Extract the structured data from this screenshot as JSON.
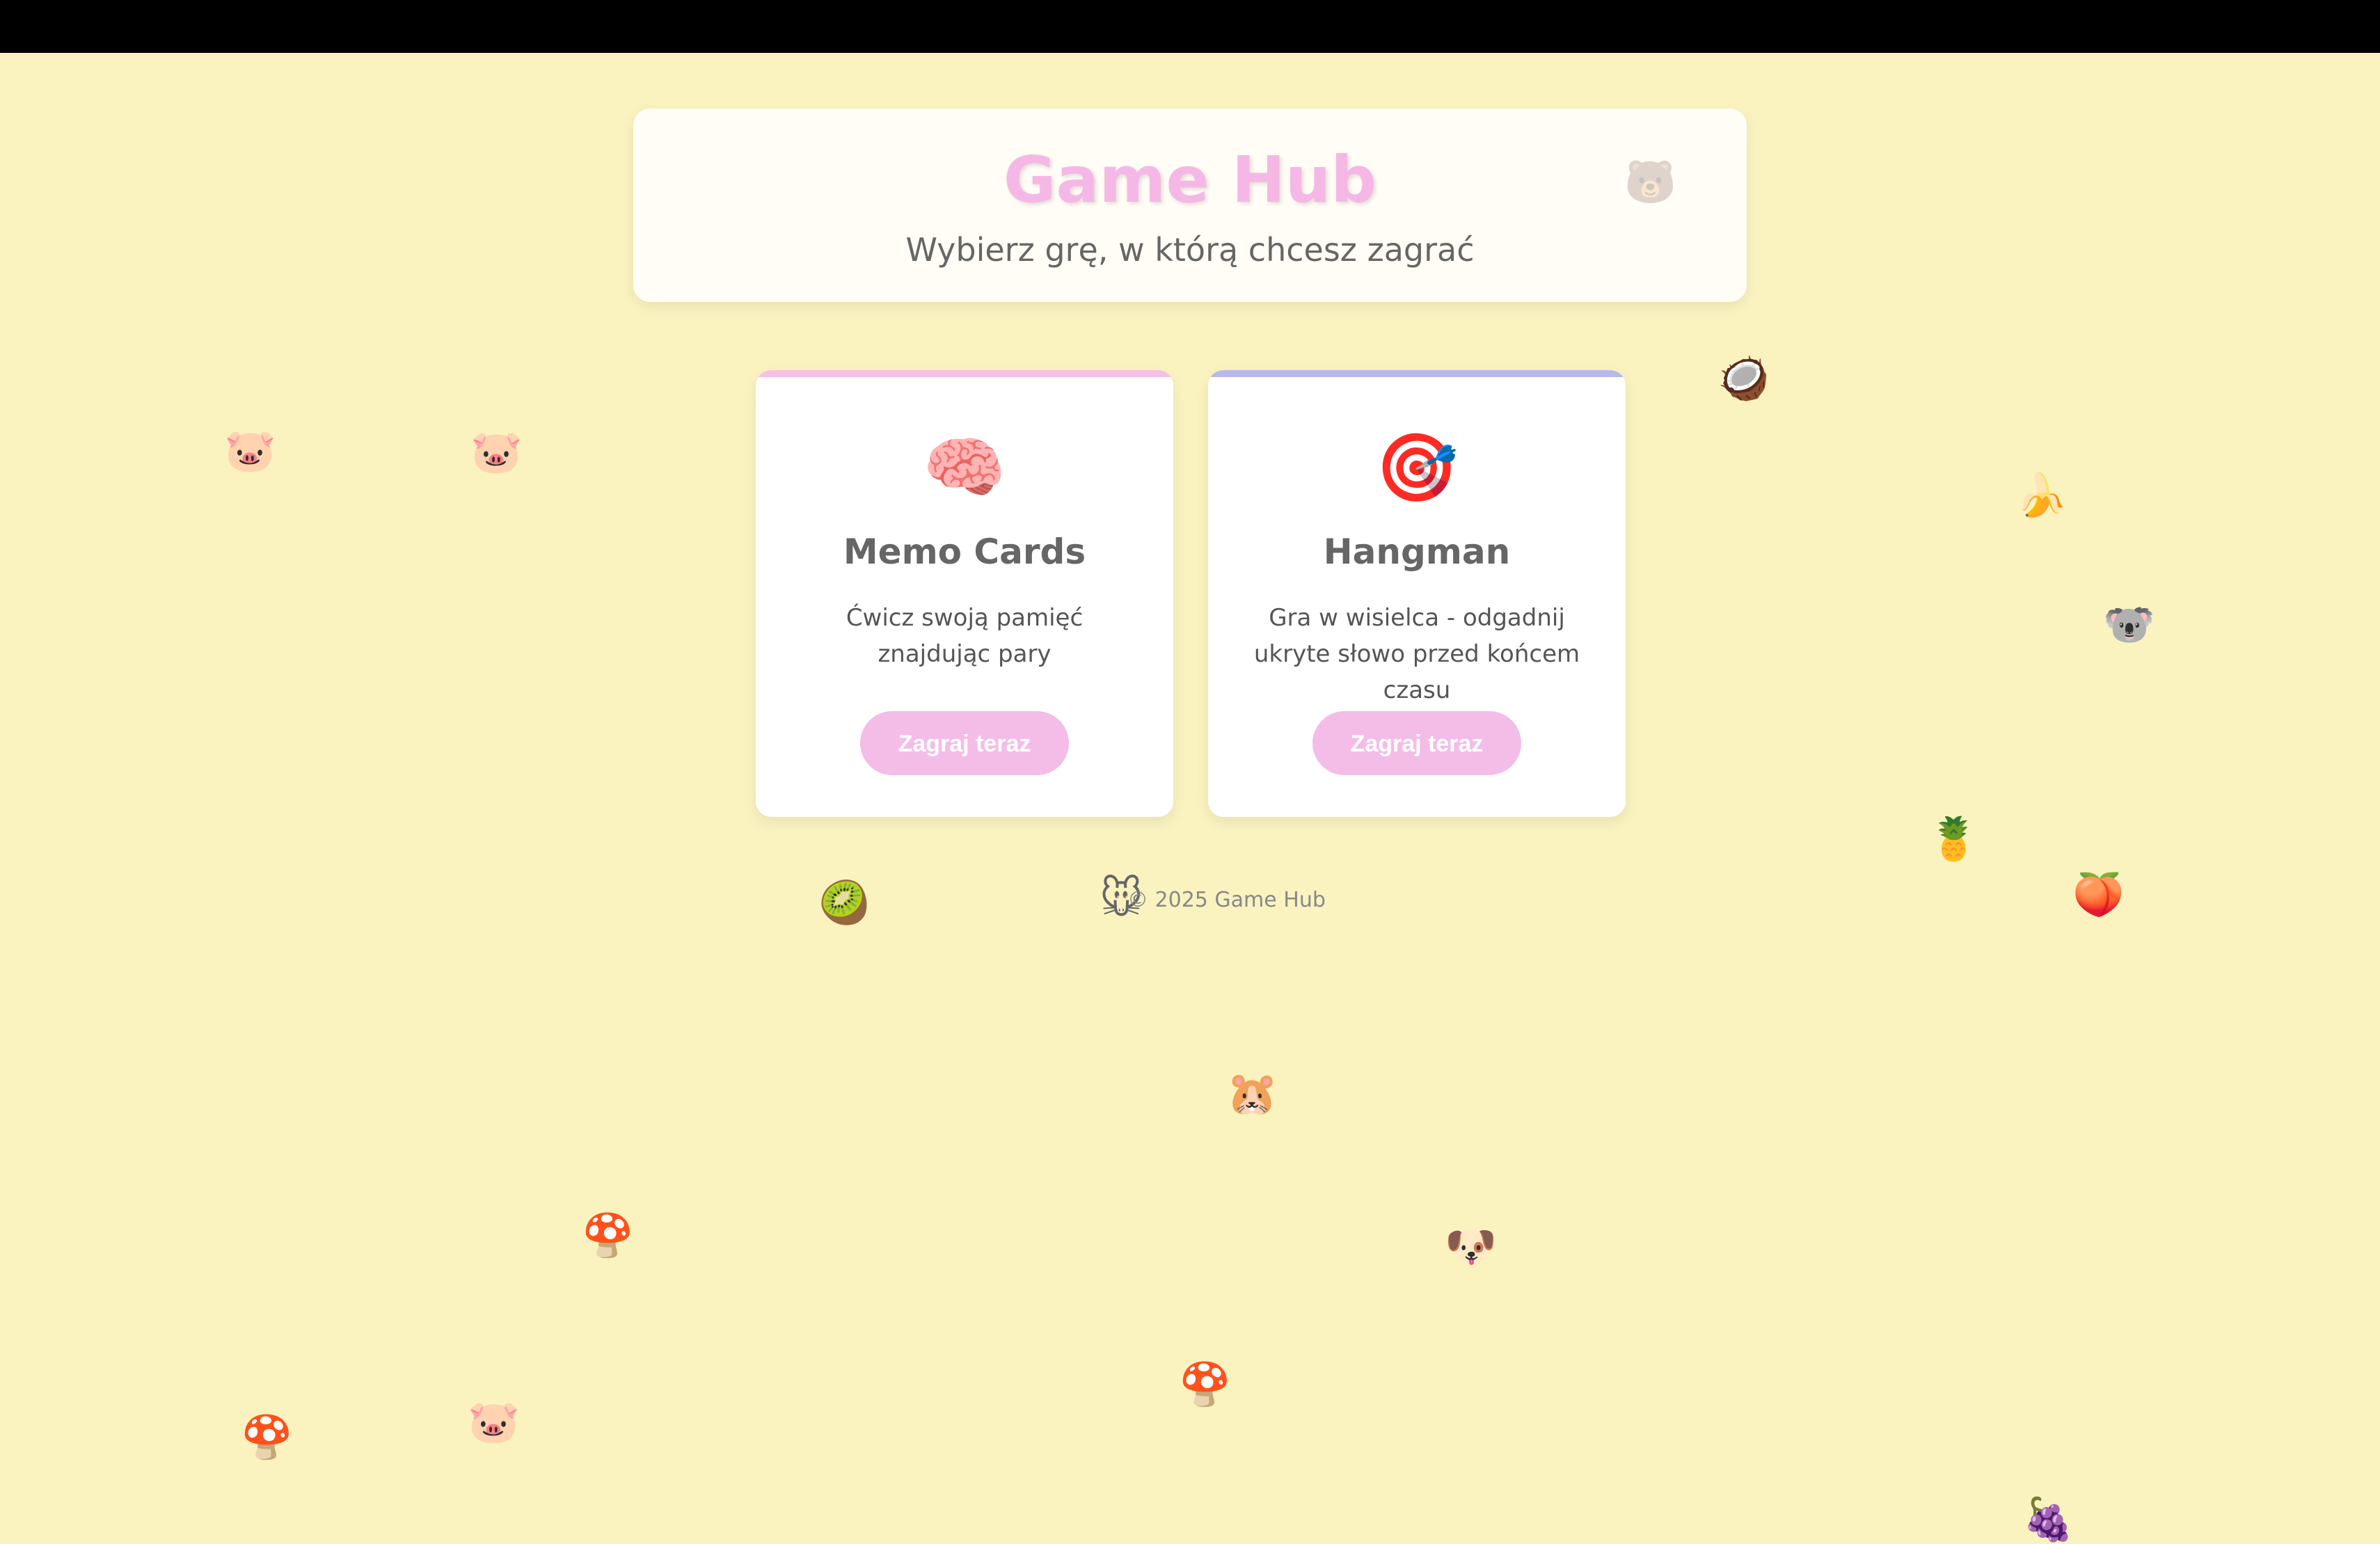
{
  "header": {
    "title": "Game Hub",
    "subtitle": "Wybierz grę, w którą chcesz zagrać",
    "corner_decor": "🐻"
  },
  "games": [
    {
      "icon": "🧠",
      "icon_name": "brain-icon",
      "name": "Memo Cards",
      "description": "Ćwicz swoją pamięć znajdując pary",
      "button_label": "Zagraj teraz",
      "accent_color": "#f6bfe7"
    },
    {
      "icon": "🎯",
      "icon_name": "target-icon",
      "name": "Hangman",
      "description": "Gra w wisielca - odgadnij ukryte słowo przed końcem czasu",
      "button_label": "Zagraj teraz",
      "accent_color": "#b9b8ee"
    }
  ],
  "footer": {
    "text": "© 2025 Game Hub"
  },
  "colors": {
    "background": "#faf3c0",
    "title_pink": "#f5b8e6",
    "button_pink": "#f3bde8"
  },
  "decorations": [
    {
      "glyph": "🐷",
      "name": "pig-icon"
    },
    {
      "glyph": "🐷",
      "name": "pig-icon"
    },
    {
      "glyph": "🥥",
      "name": "coconut-icon"
    },
    {
      "glyph": "🍌",
      "name": "banana-icon"
    },
    {
      "glyph": "🐨",
      "name": "koala-icon"
    },
    {
      "glyph": "🍍",
      "name": "pineapple-icon"
    },
    {
      "glyph": "🍑",
      "name": "peach-icon"
    },
    {
      "glyph": "🥝",
      "name": "kiwi-icon"
    },
    {
      "glyph": "🐭",
      "name": "mouse-icon"
    },
    {
      "glyph": "🐹",
      "name": "hamster-icon"
    },
    {
      "glyph": "🍄",
      "name": "mushroom-icon"
    },
    {
      "glyph": "🐶",
      "name": "dog-icon"
    },
    {
      "glyph": "🍄",
      "name": "mushroom-icon"
    },
    {
      "glyph": "🍄",
      "name": "mushroom-icon"
    },
    {
      "glyph": "🐷",
      "name": "pig-icon"
    },
    {
      "glyph": "🍇",
      "name": "grapes-icon"
    }
  ]
}
